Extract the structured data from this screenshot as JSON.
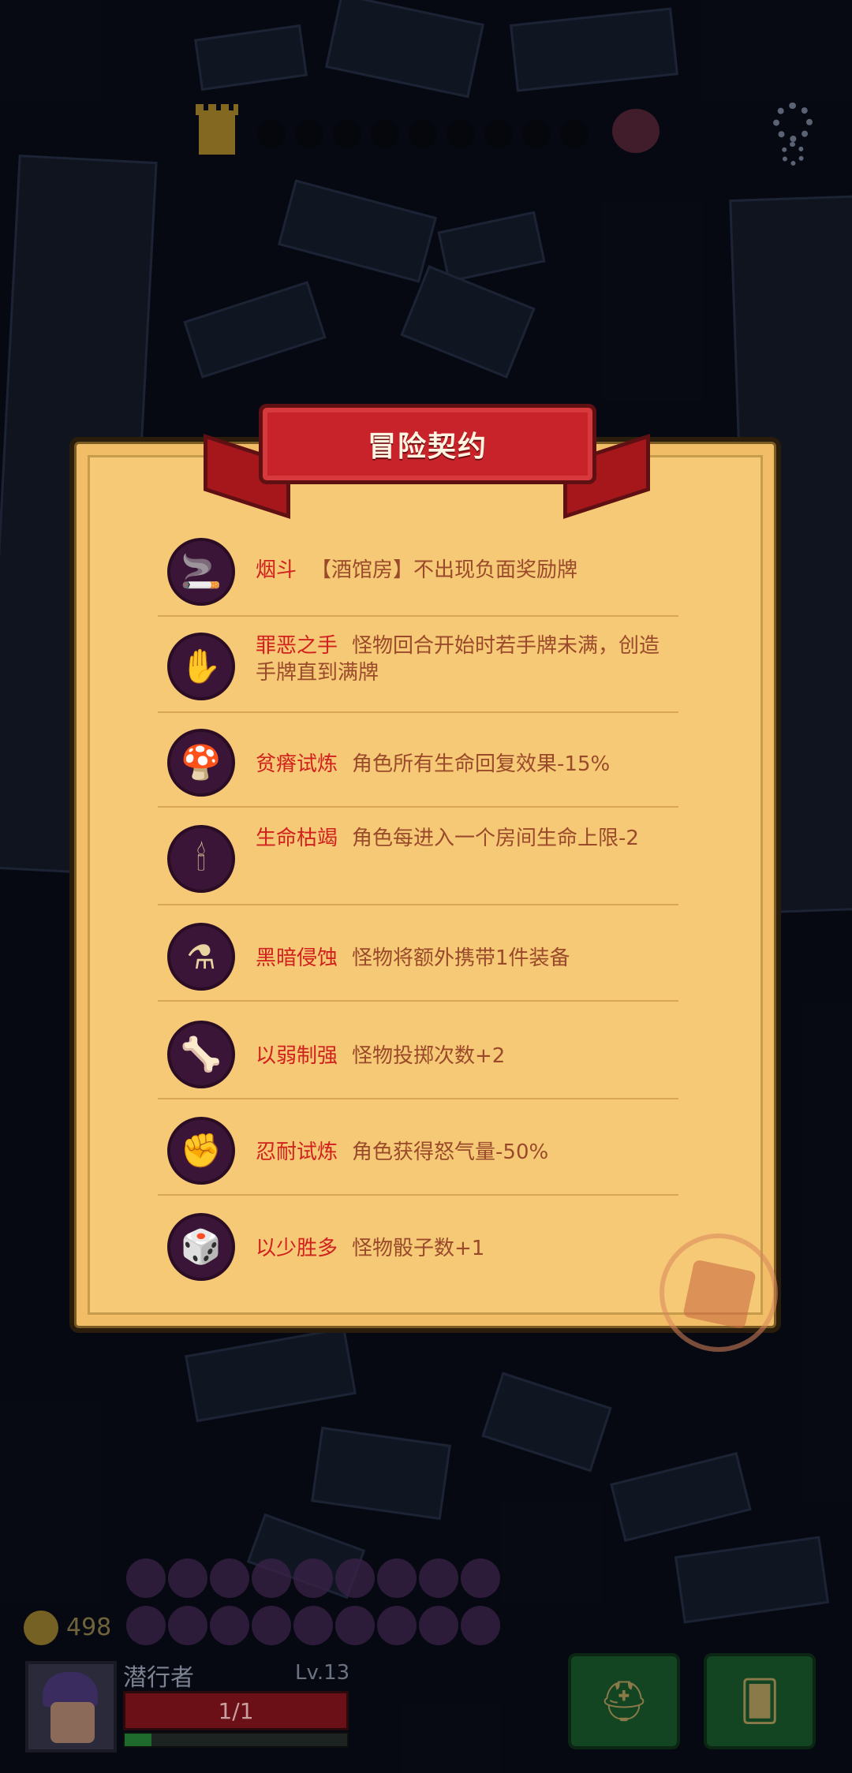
{
  "topbar": {
    "tower_icon": "tower-icon",
    "progress_dots": 9,
    "boss_icon": "horned-skull-icon",
    "settings_icon": "gear-icon"
  },
  "panel": {
    "title": "冒险契约",
    "contracts": [
      {
        "icon": "pipe-icon",
        "glyph": "🚬",
        "name": "烟斗",
        "desc": "【酒馆房】不出现负面奖励牌"
      },
      {
        "icon": "evil-hand-icon",
        "glyph": "✋",
        "name": "罪恶之手",
        "desc": "怪物回合开始时若手牌未满，创造手牌直到满牌"
      },
      {
        "icon": "mushroom-icon",
        "glyph": "🍄",
        "name": "贫瘠试炼",
        "desc": "角色所有生命回复效果-15%"
      },
      {
        "icon": "candle-icon",
        "glyph": "🕯",
        "name": "生命枯竭",
        "desc": "角色每进入一个房间生命上限-2"
      },
      {
        "icon": "potion-icon",
        "glyph": "⚗",
        "name": "黑暗侵蚀",
        "desc": "怪物将额外携带1件装备"
      },
      {
        "icon": "bone-icon",
        "glyph": "🦴",
        "name": "以弱制强",
        "desc": "怪物投掷次数+2"
      },
      {
        "icon": "fist-shield-icon",
        "glyph": "✊",
        "name": "忍耐试炼",
        "desc": "角色获得怒气量-50%"
      },
      {
        "icon": "dice-icon",
        "glyph": "🎲",
        "name": "以少胜多",
        "desc": "怪物骰子数+1"
      }
    ]
  },
  "hud": {
    "gold": "498",
    "hero_name": "潜行者",
    "hero_level": "Lv.13",
    "hp_text": "1/1",
    "xp_fraction": 0.12,
    "equip_icon": "winged-helmet-icon",
    "cards_icon": "cards-icon"
  }
}
